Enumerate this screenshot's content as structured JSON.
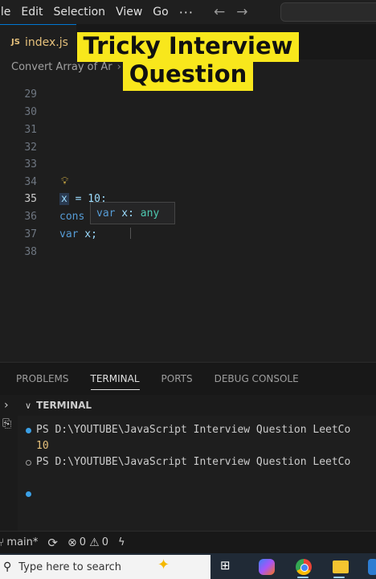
{
  "menubar": {
    "items": [
      "ile",
      "Edit",
      "Selection",
      "View",
      "Go",
      "···"
    ],
    "back_icon": "arrow-left-icon",
    "forward_icon": "arrow-right-icon"
  },
  "tabs": [
    {
      "icon": "JS",
      "label": "index.js"
    }
  ],
  "breadcrumb": {
    "items": [
      "Convert Array of Ar",
      "..."
    ]
  },
  "overlay": {
    "line1": "Tricky Interview",
    "line2": "Question"
  },
  "editor": {
    "line_numbers": [
      "29",
      "30",
      "31",
      "32",
      "33",
      "34",
      "35",
      "36",
      "37",
      "38"
    ],
    "active_line": "35",
    "code": {
      "line35_x": "x",
      "line35_rest": " = 10;",
      "line36": "cons",
      "line37_kw": "var",
      "line37_rest": " x;"
    },
    "hover": {
      "kw": "var",
      "name": " x: ",
      "type": "any"
    },
    "lightbulb_icon": "lightbulb-icon"
  },
  "panel": {
    "tabs": [
      "PROBLEMS",
      "TERMINAL",
      "PORTS",
      "DEBUG CONSOLE"
    ],
    "active_tab": "TERMINAL",
    "terminal_title": "TERMINAL",
    "lines": [
      "PS D:\\YOUTUBE\\JavaScript Interview Question LeetCo",
      "10",
      "PS D:\\YOUTUBE\\JavaScript Interview Question LeetCo"
    ]
  },
  "statusbar": {
    "branch": "main*",
    "errors": "0",
    "warnings": "0"
  },
  "taskbar": {
    "search_placeholder": "Type here to search"
  },
  "colors": {
    "editor_bg": "#1e1e1e",
    "overlay_bg": "#f8e71c",
    "keyword": "#569cd6",
    "variable": "#9cdcfe",
    "terminal_dot": "#3ba0e6"
  }
}
